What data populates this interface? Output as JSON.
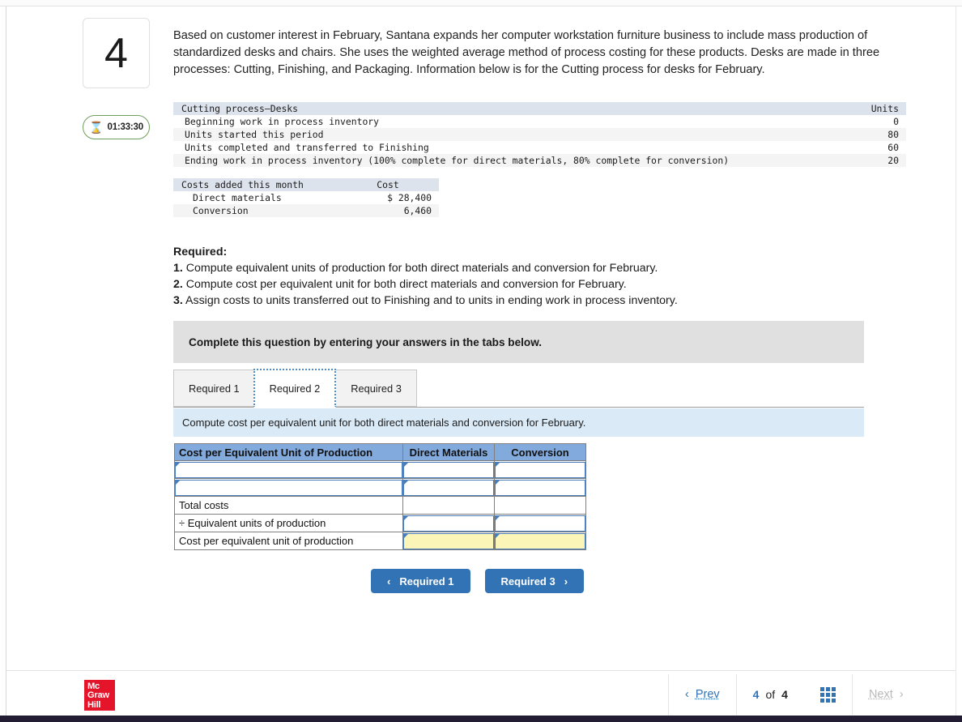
{
  "question": {
    "number": "4",
    "timer": "01:33:30",
    "timer_icon": "hourglass-icon",
    "intro": "Based on customer interest in February, Santana expands her computer workstation furniture business to include mass production of standardized desks and chairs. She uses the weighted average method of process costing for these products. Desks are made in three processes: Cutting, Finishing, and Packaging. Information below is for the Cutting process for desks for February."
  },
  "units_table": {
    "header": {
      "label": "Cutting process—Desks",
      "value": "Units"
    },
    "rows": [
      {
        "label": "Beginning work in process inventory",
        "value": "0"
      },
      {
        "label": "Units started this period",
        "value": "80"
      },
      {
        "label": "Units completed and transferred to Finishing",
        "value": "60"
      },
      {
        "label": "Ending work in process inventory (100% complete for direct materials, 80% complete for conversion)",
        "value": "20"
      }
    ]
  },
  "cost_table": {
    "header": {
      "label": "Costs added this month",
      "value": "Cost"
    },
    "rows": [
      {
        "label": "Direct materials",
        "value": "$ 28,400"
      },
      {
        "label": "Conversion",
        "value": "6,460"
      }
    ]
  },
  "required": {
    "heading": "Required:",
    "items": [
      {
        "num": "1.",
        "text": "Compute equivalent units of production for both direct materials and conversion for February."
      },
      {
        "num": "2.",
        "text": "Compute cost per equivalent unit for both direct materials and conversion for February."
      },
      {
        "num": "3.",
        "text": "Assign costs to units transferred out to Finishing and to units in ending work in process inventory."
      }
    ]
  },
  "banner": {
    "text": "Complete this question by entering your answers in the tabs below."
  },
  "tabs": [
    {
      "label": "Required 1",
      "active": false
    },
    {
      "label": "Required 2",
      "active": true
    },
    {
      "label": "Required 3",
      "active": false
    }
  ],
  "infobar": {
    "text": "Compute cost per equivalent unit for both direct materials and conversion for February."
  },
  "answer_table": {
    "headers": [
      "Cost per Equivalent Unit of Production",
      "Direct Materials",
      "Conversion"
    ],
    "rows": [
      {
        "label": "",
        "label_input": true,
        "dm": "",
        "dm_input": true,
        "cv": "",
        "cv_input": true,
        "highlight": false
      },
      {
        "label": "",
        "label_input": true,
        "dm": "",
        "dm_input": true,
        "cv": "",
        "cv_input": true,
        "highlight": false
      },
      {
        "label": "Total costs",
        "label_input": false,
        "dm": "",
        "dm_input": false,
        "cv": "",
        "cv_input": false,
        "highlight": false
      },
      {
        "label": "÷ Equivalent units of production",
        "label_input": false,
        "dm": "",
        "dm_input": true,
        "cv": "",
        "cv_input": true,
        "highlight": false
      },
      {
        "label": "Cost per equivalent unit of production",
        "label_input": false,
        "dm": "",
        "dm_input": true,
        "cv": "",
        "cv_input": true,
        "highlight": true
      }
    ]
  },
  "nav_buttons": {
    "prev": {
      "label": "Required 1",
      "chevron": "‹"
    },
    "next": {
      "label": "Required 3",
      "chevron": "›"
    }
  },
  "footer": {
    "logo": {
      "line1": "Mc",
      "line2": "Graw",
      "line3": "Hill"
    },
    "prev_label": "Prev",
    "prev_chevron": "‹",
    "next_label": "Next",
    "next_chevron": "›",
    "count_current": "4",
    "count_of": "of",
    "count_total": "4",
    "grid_icon": "grid-icon"
  },
  "colors": {
    "accent_blue": "#3273b5",
    "table_header_blue": "#83aadd",
    "input_border": "#4a7ebb",
    "highlight_yellow": "#fbf6b8",
    "info_bar": "#daeaf7",
    "banner_gray": "#e0e0e0",
    "logo_red": "#e4152b",
    "bottom_bar": "#221d33"
  }
}
